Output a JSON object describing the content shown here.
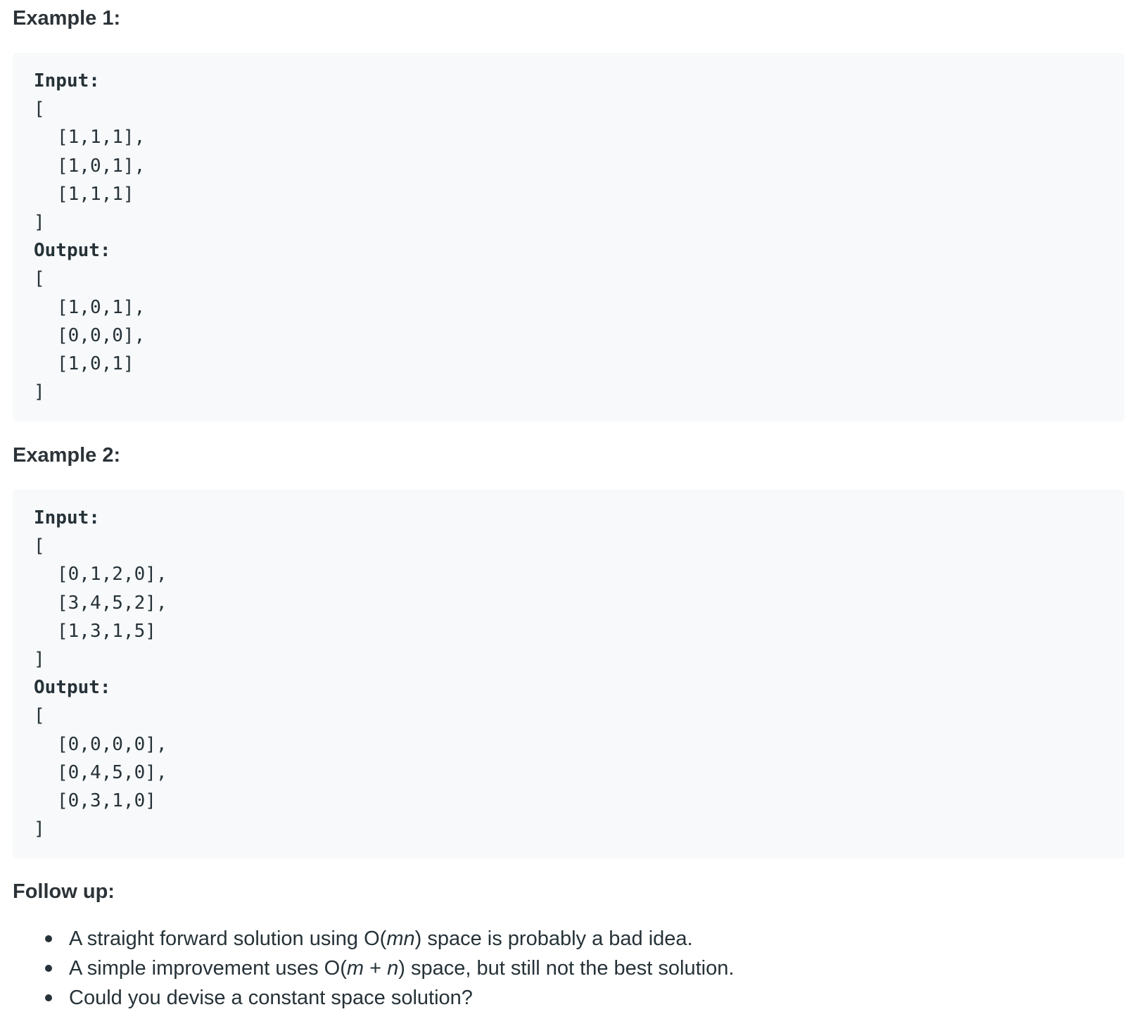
{
  "example1": {
    "heading": "Example 1:",
    "input_label": "Input:",
    "input_open": "[",
    "input_rows": [
      "[1,1,1],",
      "[1,0,1],",
      "[1,1,1]"
    ],
    "input_close": "]",
    "output_label": "Output:",
    "output_open": "[",
    "output_rows": [
      "[1,0,1],",
      "[0,0,0],",
      "[1,0,1]"
    ],
    "output_close": "]"
  },
  "example2": {
    "heading": "Example 2:",
    "input_label": "Input:",
    "input_open": "[",
    "input_rows": [
      "[0,1,2,0],",
      "[3,4,5,2],",
      "[1,3,1,5]"
    ],
    "input_close": "]",
    "output_label": "Output:",
    "output_open": "[",
    "output_rows": [
      "[0,0,0,0],",
      "[0,4,5,0],",
      "[0,3,1,0]"
    ],
    "output_close": "]"
  },
  "followup": {
    "heading": "Follow up:",
    "items": [
      {
        "before": "A straight forward solution using O(",
        "em": "mn",
        "after": ") space is probably a bad idea."
      },
      {
        "before": "A simple improvement uses O(",
        "em": "m",
        "middle": " + ",
        "em2": "n",
        "after": ") space, but still not the best solution."
      },
      {
        "before": "Could you devise a constant space solution?"
      }
    ]
  }
}
